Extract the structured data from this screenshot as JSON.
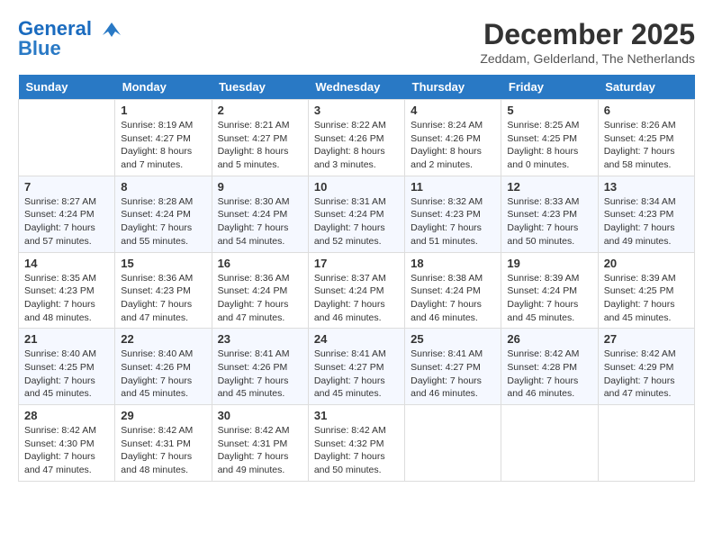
{
  "logo": {
    "line1": "General",
    "line2": "Blue"
  },
  "title": "December 2025",
  "subtitle": "Zeddam, Gelderland, The Netherlands",
  "days": [
    "Sunday",
    "Monday",
    "Tuesday",
    "Wednesday",
    "Thursday",
    "Friday",
    "Saturday"
  ],
  "weeks": [
    [
      {
        "date": "",
        "text": ""
      },
      {
        "date": "1",
        "text": "Sunrise: 8:19 AM\nSunset: 4:27 PM\nDaylight: 8 hours and 7 minutes."
      },
      {
        "date": "2",
        "text": "Sunrise: 8:21 AM\nSunset: 4:27 PM\nDaylight: 8 hours and 5 minutes."
      },
      {
        "date": "3",
        "text": "Sunrise: 8:22 AM\nSunset: 4:26 PM\nDaylight: 8 hours and 3 minutes."
      },
      {
        "date": "4",
        "text": "Sunrise: 8:24 AM\nSunset: 4:26 PM\nDaylight: 8 hours and 2 minutes."
      },
      {
        "date": "5",
        "text": "Sunrise: 8:25 AM\nSunset: 4:25 PM\nDaylight: 8 hours and 0 minutes."
      },
      {
        "date": "6",
        "text": "Sunrise: 8:26 AM\nSunset: 4:25 PM\nDaylight: 7 hours and 58 minutes."
      }
    ],
    [
      {
        "date": "7",
        "text": "Sunrise: 8:27 AM\nSunset: 4:24 PM\nDaylight: 7 hours and 57 minutes."
      },
      {
        "date": "8",
        "text": "Sunrise: 8:28 AM\nSunset: 4:24 PM\nDaylight: 7 hours and 55 minutes."
      },
      {
        "date": "9",
        "text": "Sunrise: 8:30 AM\nSunset: 4:24 PM\nDaylight: 7 hours and 54 minutes."
      },
      {
        "date": "10",
        "text": "Sunrise: 8:31 AM\nSunset: 4:24 PM\nDaylight: 7 hours and 52 minutes."
      },
      {
        "date": "11",
        "text": "Sunrise: 8:32 AM\nSunset: 4:23 PM\nDaylight: 7 hours and 51 minutes."
      },
      {
        "date": "12",
        "text": "Sunrise: 8:33 AM\nSunset: 4:23 PM\nDaylight: 7 hours and 50 minutes."
      },
      {
        "date": "13",
        "text": "Sunrise: 8:34 AM\nSunset: 4:23 PM\nDaylight: 7 hours and 49 minutes."
      }
    ],
    [
      {
        "date": "14",
        "text": "Sunrise: 8:35 AM\nSunset: 4:23 PM\nDaylight: 7 hours and 48 minutes."
      },
      {
        "date": "15",
        "text": "Sunrise: 8:36 AM\nSunset: 4:23 PM\nDaylight: 7 hours and 47 minutes."
      },
      {
        "date": "16",
        "text": "Sunrise: 8:36 AM\nSunset: 4:24 PM\nDaylight: 7 hours and 47 minutes."
      },
      {
        "date": "17",
        "text": "Sunrise: 8:37 AM\nSunset: 4:24 PM\nDaylight: 7 hours and 46 minutes."
      },
      {
        "date": "18",
        "text": "Sunrise: 8:38 AM\nSunset: 4:24 PM\nDaylight: 7 hours and 46 minutes."
      },
      {
        "date": "19",
        "text": "Sunrise: 8:39 AM\nSunset: 4:24 PM\nDaylight: 7 hours and 45 minutes."
      },
      {
        "date": "20",
        "text": "Sunrise: 8:39 AM\nSunset: 4:25 PM\nDaylight: 7 hours and 45 minutes."
      }
    ],
    [
      {
        "date": "21",
        "text": "Sunrise: 8:40 AM\nSunset: 4:25 PM\nDaylight: 7 hours and 45 minutes."
      },
      {
        "date": "22",
        "text": "Sunrise: 8:40 AM\nSunset: 4:26 PM\nDaylight: 7 hours and 45 minutes."
      },
      {
        "date": "23",
        "text": "Sunrise: 8:41 AM\nSunset: 4:26 PM\nDaylight: 7 hours and 45 minutes."
      },
      {
        "date": "24",
        "text": "Sunrise: 8:41 AM\nSunset: 4:27 PM\nDaylight: 7 hours and 45 minutes."
      },
      {
        "date": "25",
        "text": "Sunrise: 8:41 AM\nSunset: 4:27 PM\nDaylight: 7 hours and 46 minutes."
      },
      {
        "date": "26",
        "text": "Sunrise: 8:42 AM\nSunset: 4:28 PM\nDaylight: 7 hours and 46 minutes."
      },
      {
        "date": "27",
        "text": "Sunrise: 8:42 AM\nSunset: 4:29 PM\nDaylight: 7 hours and 47 minutes."
      }
    ],
    [
      {
        "date": "28",
        "text": "Sunrise: 8:42 AM\nSunset: 4:30 PM\nDaylight: 7 hours and 47 minutes."
      },
      {
        "date": "29",
        "text": "Sunrise: 8:42 AM\nSunset: 4:31 PM\nDaylight: 7 hours and 48 minutes."
      },
      {
        "date": "30",
        "text": "Sunrise: 8:42 AM\nSunset: 4:31 PM\nDaylight: 7 hours and 49 minutes."
      },
      {
        "date": "31",
        "text": "Sunrise: 8:42 AM\nSunset: 4:32 PM\nDaylight: 7 hours and 50 minutes."
      },
      {
        "date": "",
        "text": ""
      },
      {
        "date": "",
        "text": ""
      },
      {
        "date": "",
        "text": ""
      }
    ]
  ]
}
